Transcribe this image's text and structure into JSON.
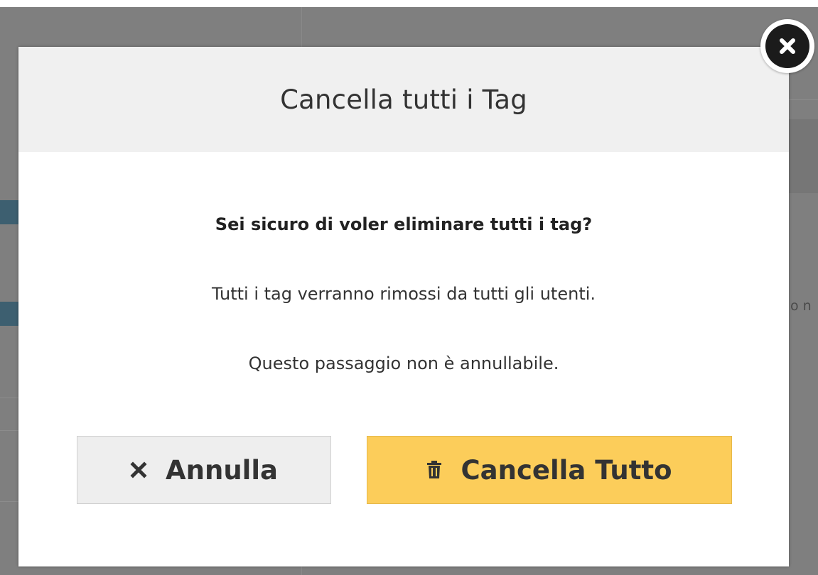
{
  "dialog": {
    "title": "Cancella tutti i Tag",
    "question": "Sei sicuro di voler eliminare tutti i tag?",
    "info_line_1": "Tutti i tag verranno rimossi da tutti gli utenti.",
    "info_line_2": "Questo passaggio non è annullabile.",
    "cancel_button": {
      "label": "Annulla",
      "icon": "x-icon"
    },
    "confirm_button": {
      "label": "Cancella Tutto",
      "icon": "trash-icon"
    },
    "close_icon": "close-circle-icon"
  },
  "background": {
    "partial_text": "o n"
  },
  "colors": {
    "overlay": "#7f7f7f",
    "header_bg": "#f0f0f0",
    "confirm_bg": "#fccd5a",
    "cancel_bg": "#eeeeee",
    "accent_left": "#3d5f70"
  }
}
